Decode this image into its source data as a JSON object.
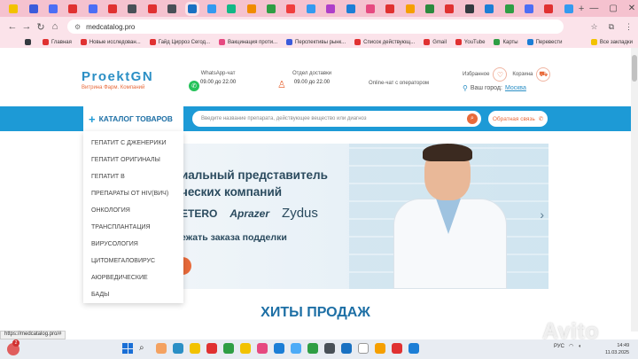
{
  "browser": {
    "tab_colors": [
      "#f2c200",
      "#3b5bdb",
      "#4c6ef5",
      "#e03131",
      "#4c6ef5",
      "#e03131",
      "#495057",
      "#e03131",
      "#495057",
      "#1971c2",
      "#339af0",
      "#12b886",
      "#f08c00",
      "#2f9e44",
      "#f03e3e",
      "#339af0",
      "#ae3ec9",
      "#1c7ed6",
      "#e64980",
      "#e03131",
      "#f59f00",
      "#2b8a3e",
      "#e03131",
      "#343a40",
      "#1c7ed6",
      "#2f9e44",
      "#4c6ef5",
      "#e03131",
      "#339af0"
    ],
    "active_tab_index": 9,
    "new_tab": "+",
    "window_controls": [
      "—",
      "▢",
      "✕"
    ],
    "nav": {
      "back": "←",
      "forward": "→",
      "reload": "↻",
      "home": "⌂"
    },
    "url": "medcatalog.pro",
    "bookmarks": [
      {
        "label": "Главная",
        "color": "#e03131"
      },
      {
        "label": "Новые исследован...",
        "color": "#e03131"
      },
      {
        "label": "Гайд Цирроз Сегод...",
        "color": "#e03131"
      },
      {
        "label": "Вакцинация проти...",
        "color": "#e64980"
      },
      {
        "label": "Перспективы рынк...",
        "color": "#3b5bdb"
      },
      {
        "label": "Список действующ...",
        "color": "#e03131"
      },
      {
        "label": "Gmail",
        "color": "#e03131"
      },
      {
        "label": "YouTube",
        "color": "#e03131"
      },
      {
        "label": "Карты",
        "color": "#2f9e44"
      },
      {
        "label": "Перевести",
        "color": "#1c7ed6"
      }
    ],
    "all_bookmarks": "Все закладки",
    "status_url": "https://medcatalog.pro/#"
  },
  "header": {
    "logo_text": "ProektGN",
    "logo_subtitle": "Витрина Фарм. Компаний",
    "whatsapp": {
      "label": "WhatsApp-чат",
      "hours": "09.00 до 22.00"
    },
    "delivery": {
      "label": "Отдел доставки",
      "hours": "09.00 до 22.00"
    },
    "online_chat": "Online-чат с оператором",
    "favorites": "Избранное",
    "cart": "Корзина",
    "city_label": "Ваш город:",
    "city": "Москва"
  },
  "navbar": {
    "catalog_label": "КАТАЛОГ ТОВАРОВ",
    "search_placeholder": "Введите название препарата, действующее вещество или диагноз",
    "callback": "Обратная связь"
  },
  "catalog_menu": [
    "ГЕПАТИТ С ДЖЕНЕРИКИ",
    "ГЕПАТИТ ОРИГИНАЛЫ",
    "ГЕПАТИТ В",
    "ПРЕПАРАТЫ ОТ HIV(ВИЧ)",
    "ОНКОЛОГИЯ",
    "ТРАНСПЛАНТАЦИЯ",
    "ВИРУСОЛОГИЯ",
    "ЦИТОМЕГАЛОВИРУС",
    "АЮРВЕДИЧЕСКИЕ",
    "БАДЫ"
  ],
  "banner": {
    "line1": "иальный представитель",
    "line2": "ческих компаний",
    "brands": [
      "ETERO",
      "Aprazer",
      "Zydus"
    ],
    "subline": "ежать заказа подделки"
  },
  "hits_title": "ХИТЫ ПРОДАЖ",
  "taskbar": {
    "notification_count": "2",
    "language": "РУС",
    "time": "14:49",
    "date": "11.03.2025"
  },
  "watermark": "Avito",
  "colors": {
    "accent_blue": "#1d9ad6",
    "accent_orange": "#e86a3a",
    "chrome_pink": "#f5c2cf"
  }
}
